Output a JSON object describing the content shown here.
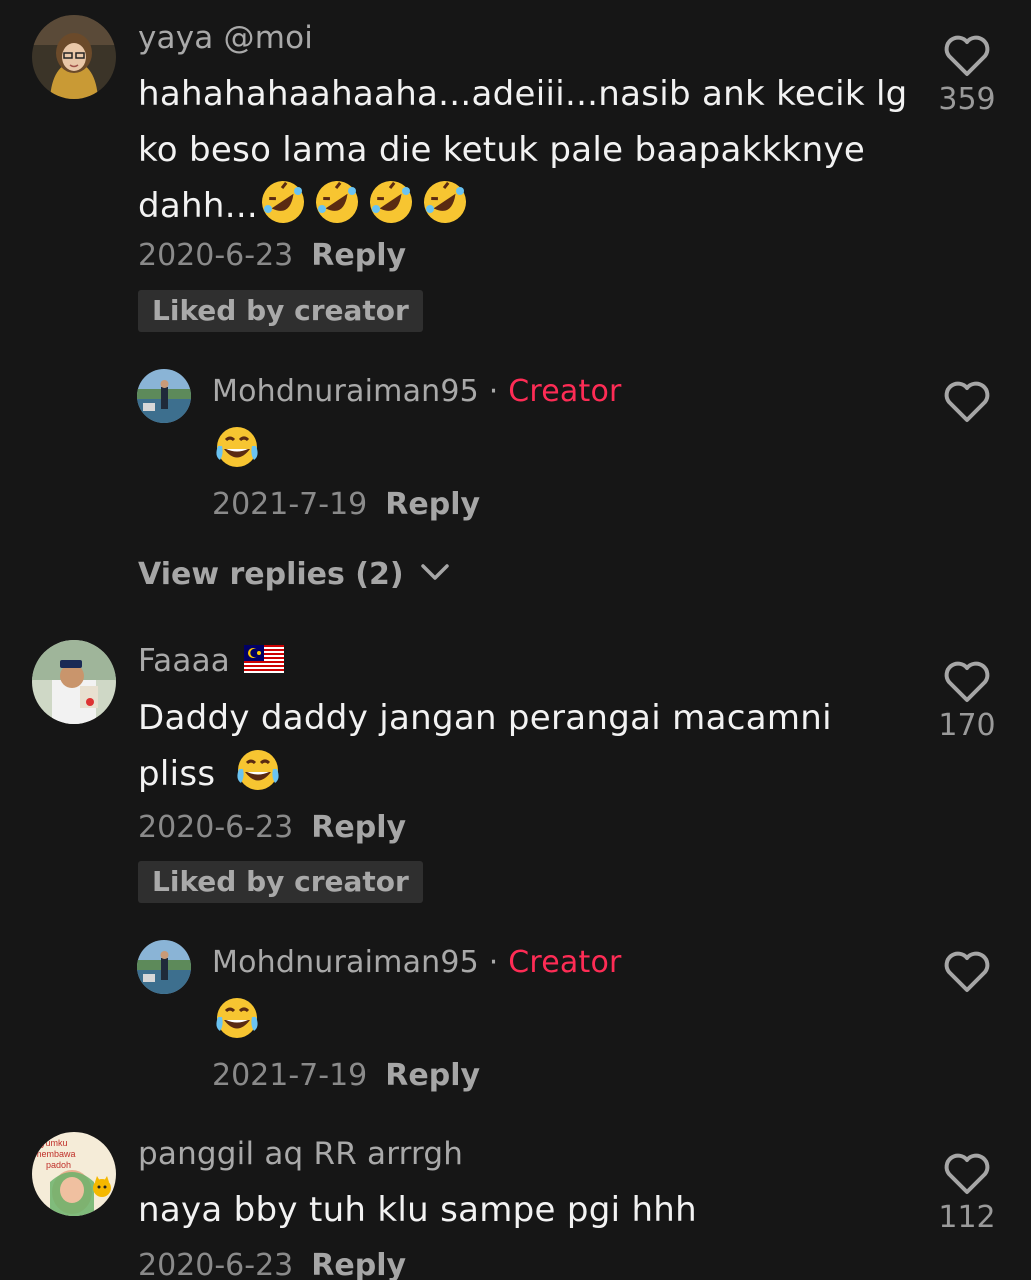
{
  "colors": {
    "background": "#161616",
    "creator_tag": "#fe2c55",
    "liked_bg": "#2f2f2f"
  },
  "comments": [
    {
      "username": "yaya @moi",
      "text_line1": "hahahahaahaaha...adeiii...nasib ank kecik lg",
      "text_line2": "ko beso lama die ketuk pale baapakkknye",
      "text_line3": "dahh...",
      "emojis": [
        "rolling-on-floor-laughing-emoji",
        "rolling-on-floor-laughing-emoji",
        "rolling-on-floor-laughing-emoji",
        "rolling-on-floor-laughing-emoji"
      ],
      "date": "2020-6-23",
      "reply_label": "Reply",
      "liked_label": "Liked by creator",
      "like_count": "359",
      "reply": {
        "username": "Mohdnuraiman95",
        "separator": "·",
        "creator_label": "Creator",
        "emoji": "tears-of-joy-emoji",
        "date": "2021-7-19",
        "reply_label": "Reply"
      },
      "view_replies": "View replies (2)"
    },
    {
      "username": "Faaaa",
      "flag": "malaysia-flag-emoji",
      "text_line1": "Daddy daddy jangan perangai macamni",
      "text_line2": "pliss",
      "emoji": "tears-of-joy-emoji",
      "date": "2020-6-23",
      "reply_label": "Reply",
      "liked_label": "Liked by creator",
      "like_count": "170",
      "reply": {
        "username": "Mohdnuraiman95",
        "separator": "·",
        "creator_label": "Creator",
        "emoji": "tears-of-joy-emoji",
        "date": "2021-7-19",
        "reply_label": "Reply"
      }
    },
    {
      "username": "panggil aq RR arrrgh",
      "text_line1": "naya bby tuh klu sampe pgi hhh",
      "date": "2020-6-23",
      "reply_label": "Reply",
      "like_count": "112",
      "avatar_text_line1": "ayumku",
      "avatar_text_line2": "membawa",
      "avatar_text_line3": "padoh"
    }
  ]
}
